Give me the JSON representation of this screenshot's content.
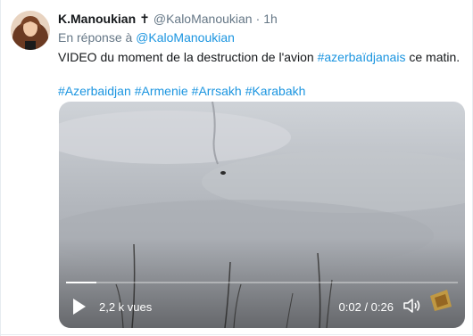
{
  "tweet": {
    "author_name": "K.Manoukian",
    "author_symbol": "✝",
    "handle": "@KaloManoukian",
    "separator": "·",
    "timestamp": "1h",
    "reply_prefix": "En réponse à",
    "reply_handle": "@KaloManoukian",
    "text_before": "VIDEO du moment de la destruction de l'avion ",
    "text_link": "#azerbaïdjanais",
    "text_after": " ce matin.",
    "hashtags": [
      "#Azerbaidjan",
      "#Armenie",
      "#Arrsakh",
      "#Karabakh"
    ]
  },
  "video": {
    "views": "2,2 k vues",
    "time_display": "0:02 / 0:26",
    "progress_fraction": 0.077,
    "play_icon": "play-icon",
    "volume_icon": "volume-icon"
  },
  "colors": {
    "link": "#1b95e0",
    "text": "#14171a",
    "secondary": "#657786"
  }
}
